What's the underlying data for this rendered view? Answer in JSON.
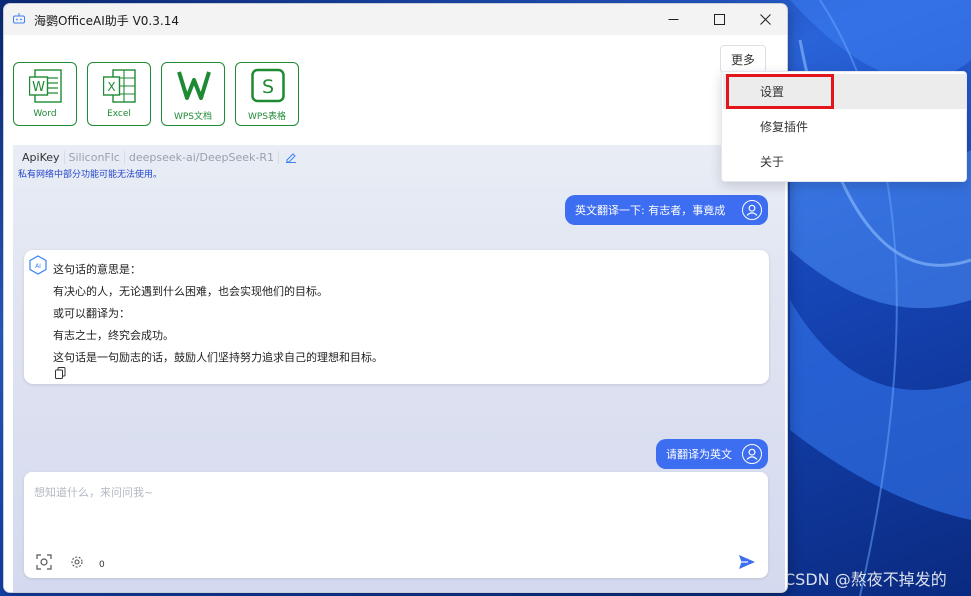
{
  "window": {
    "title": "海鹦OfficeAI助手 V0.3.14",
    "minimize_icon": "minimize-icon",
    "maximize_icon": "maximize-icon",
    "close_icon": "close-icon"
  },
  "toolbar": {
    "more_label": "更多",
    "apps": [
      {
        "label": "Word",
        "icon": "word-icon"
      },
      {
        "label": "Excel",
        "icon": "excel-icon"
      },
      {
        "label": "WPS文档",
        "icon": "wps-writer-icon"
      },
      {
        "label": "WPS表格",
        "icon": "wps-sheets-icon"
      }
    ]
  },
  "menu": {
    "items": [
      {
        "label": "设置"
      },
      {
        "label": "修复插件"
      },
      {
        "label": "关于"
      }
    ]
  },
  "model_bar": {
    "key_label": "ApiKey",
    "provider": "SiliconFlc",
    "model": "deepseek-ai/DeepSeek-R1",
    "edit_icon": "pencil-icon"
  },
  "notice": "私有网络中部分功能可能无法使用。",
  "messages": {
    "user1": "英文翻译一下: 有志者，事竟成",
    "ai_lines": [
      "这句话的意思是：",
      "有决心的人，无论遇到什么困难，也会实现他们的目标。",
      "或可以翻译为：",
      "有志之士，终究会成功。",
      "这句话是一句励志的话，鼓励人们坚持努力追求自己的理想和目标。"
    ],
    "user2": "请翻译为英文"
  },
  "input": {
    "placeholder": "想知道什么，来问问我~",
    "value": "",
    "count": "0"
  },
  "colors": {
    "accent_green": "#1f8a34",
    "user_bubble": "#3d6df0",
    "highlight_red": "#e0161b"
  },
  "watermark": "CSDN @熬夜不掉发的"
}
